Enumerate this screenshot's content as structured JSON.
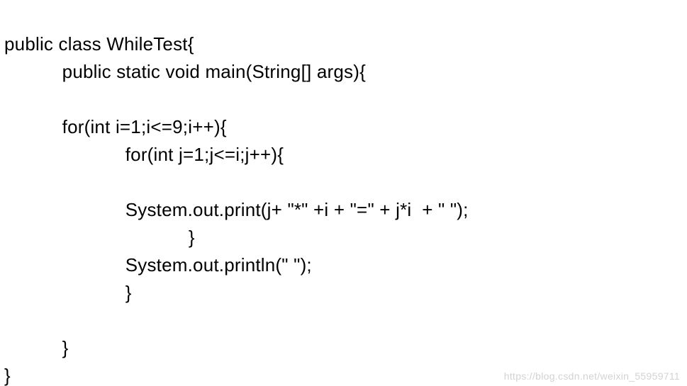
{
  "code": {
    "lines": [
      "public class WhileTest{",
      "           public static void main(String[] args){",
      "",
      "           for(int i=1;i<=9;i++){",
      "                       for(int j=1;j<=i;j++){",
      "",
      "                       System.out.print(j+ \"*\" +i + \"=\" + j*i  + \" \");",
      "                                   }",
      "                       System.out.println(\" \");",
      "                       }",
      "",
      "           }",
      "}"
    ]
  },
  "watermark": "https://blog.csdn.net/weixin_55959711"
}
